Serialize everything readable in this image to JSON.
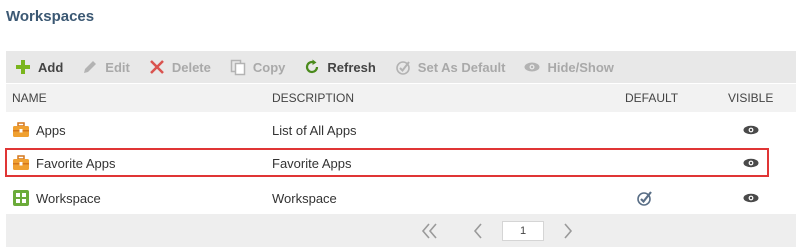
{
  "page": {
    "title": "Workspaces"
  },
  "toolbar": {
    "add": "Add",
    "edit": "Edit",
    "delete": "Delete",
    "copy": "Copy",
    "refresh": "Refresh",
    "set_default": "Set As Default",
    "hide_show": "Hide/Show"
  },
  "columns": {
    "name": "NAME",
    "description": "DESCRIPTION",
    "default": "DEFAULT",
    "visible": "VISIBLE"
  },
  "rows": [
    {
      "name": "Apps",
      "description": "List of All Apps",
      "icon": "briefcase-icon",
      "default": false,
      "visible": true
    },
    {
      "name": "Favorite Apps",
      "description": "Favorite Apps",
      "icon": "briefcase-icon",
      "default": false,
      "visible": true,
      "highlighted": true
    },
    {
      "name": "Workspace",
      "description": "Workspace",
      "icon": "grid-icon",
      "default": true,
      "visible": true
    }
  ],
  "pager": {
    "current_page": "1"
  },
  "colors": {
    "title": "#3b5873",
    "highlight_border": "#e03535",
    "add_icon": "#7ab51d",
    "refresh_icon": "#4a8a1c"
  }
}
